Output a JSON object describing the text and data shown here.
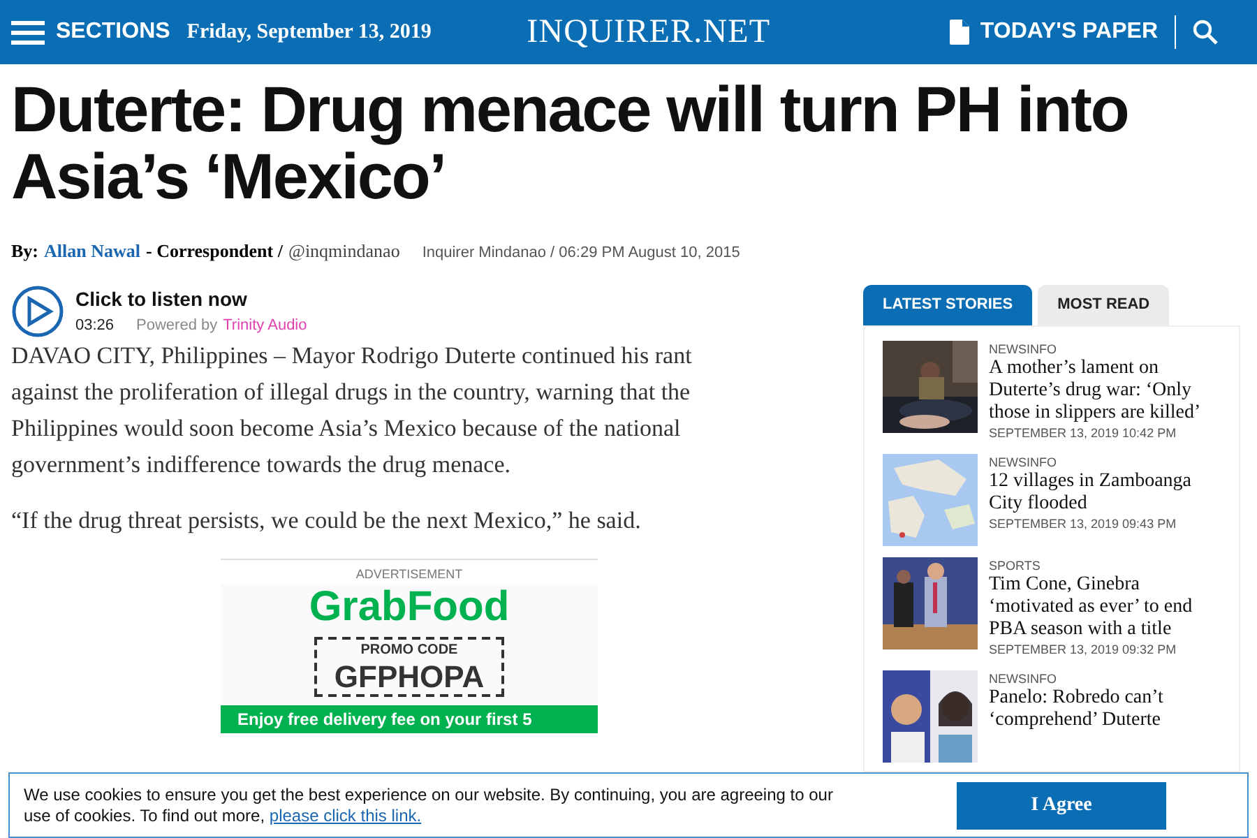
{
  "header": {
    "sections_label": "SECTIONS",
    "date": "Friday, September 13, 2019",
    "logo": "INQUIRER.NET",
    "todays_paper": "TODAY'S PAPER"
  },
  "article": {
    "headline": "Duterte: Drug menace will turn PH into Asia’s ‘Mexico’",
    "byline": {
      "prefix": "By:",
      "author": "Allan Nawal",
      "role": "- Correspondent /",
      "handle": "@inqmindanao",
      "source": "Inquirer Mindanao / 06:29 PM August 10, 2015"
    },
    "audio": {
      "title": "Click to listen now",
      "duration": "03:26",
      "powered_by": "Powered by",
      "provider": "Trinity Audio"
    },
    "paragraphs": [
      "DAVAO CITY, Philippines – Mayor Rodrigo Duterte continued his rant against the proliferation of illegal drugs in the country, warning that the Philippines would soon become Asia’s Mexico because of the national government’s indifference towards the drug menace.",
      "“If the drug threat persists, we could be the next Mexico,” he said."
    ],
    "ad": {
      "label": "ADVERTISEMENT",
      "brand": "GrabFood",
      "promo_label": "PROMO CODE",
      "promo_code": "GFPHOPA",
      "banner": "Enjoy free delivery fee on your first 5"
    }
  },
  "sidebar": {
    "tabs": [
      {
        "label": "LATEST STORIES",
        "selected": true
      },
      {
        "label": "MOST READ",
        "selected": false
      }
    ],
    "stories": [
      {
        "category": "NEWSINFO",
        "title": "A mother’s lament on Duterte’s drug war: ‘Only those in slippers are killed’",
        "time": "SEPTEMBER 13, 2019 10:42 PM"
      },
      {
        "category": "NEWSINFO",
        "title": "12 villages in Zamboanga City flooded",
        "time": "SEPTEMBER 13, 2019 09:43 PM"
      },
      {
        "category": "SPORTS",
        "title": "Tim Cone, Ginebra ‘motivated as ever’ to end PBA season with a title",
        "time": "SEPTEMBER 13, 2019 09:32 PM"
      },
      {
        "category": "NEWSINFO",
        "title": "Panelo: Robredo can’t ‘comprehend’ Duterte"
      }
    ]
  },
  "cookie_banner": {
    "text": "We use cookies to ensure you get the best experience on our website. By continuing, you are agreeing to our use of cookies. To find out more,",
    "link": "please click this link.",
    "button": "I Agree"
  }
}
